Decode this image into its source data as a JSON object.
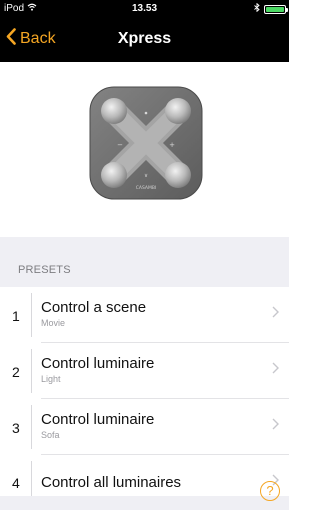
{
  "status_bar": {
    "device": "iPod",
    "time": "13.53"
  },
  "nav": {
    "back_label": "Back",
    "title": "Xpress"
  },
  "device": {
    "brand": "CASAMBI"
  },
  "presets": {
    "header": "PRESETS",
    "items": [
      {
        "number": "1",
        "title": "Control a scene",
        "subtitle": "Movie"
      },
      {
        "number": "2",
        "title": "Control luminaire",
        "subtitle": "Light"
      },
      {
        "number": "3",
        "title": "Control luminaire",
        "subtitle": "Sofa"
      },
      {
        "number": "4",
        "title": "Control all luminaires",
        "subtitle": ""
      }
    ]
  },
  "help": {
    "label": "?"
  },
  "colors": {
    "accent": "#f5a623",
    "battery": "#4cd964",
    "group_background": "#efeff4"
  }
}
